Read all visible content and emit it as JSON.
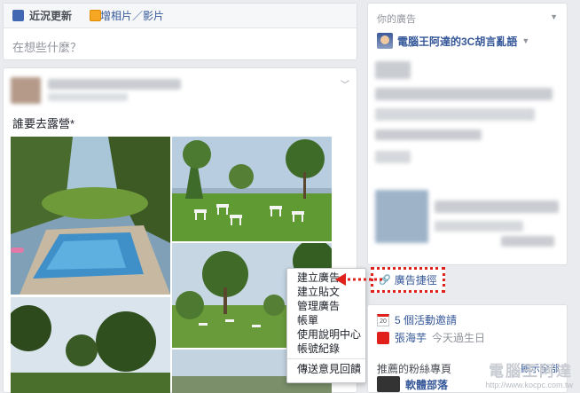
{
  "composer": {
    "tab_status": "近況更新",
    "tab_photo": "新增相片／影片",
    "placeholder": "在想些什麼？"
  },
  "post": {
    "text": "誰要去露營*"
  },
  "ads": {
    "title": "你的廣告",
    "page_name": "電腦王阿達的3C胡言亂語",
    "shortcut_label": "廣告捷徑"
  },
  "menu": {
    "items": [
      "建立廣告",
      "建立貼文",
      "管理廣告",
      "帳單",
      "使用說明中心",
      "帳號紀錄"
    ],
    "feedback": "傳送意見回饋"
  },
  "events": {
    "invites": "5 個活動邀請",
    "birthday_name": "張海芋",
    "birthday_suffix": "今天過生日",
    "calendar_day": "20",
    "fans_title": "推薦的粉絲專頁",
    "fans_more": "顯示全部",
    "fan_page_name": "軟體部落"
  },
  "watermark": {
    "title": "電腦王阿達",
    "url": "http://www.kocpc.com.tw"
  },
  "colors": {
    "accent": "#365899",
    "highlight": "#e0211b",
    "background": "#e9ebee"
  },
  "icons": [
    "edit-icon",
    "photo-icon",
    "chevron-down-icon",
    "link-icon",
    "calendar-icon",
    "gift-icon"
  ]
}
